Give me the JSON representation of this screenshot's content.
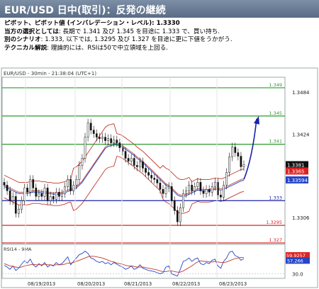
{
  "header": {
    "title": "EUR/USD 日中(取引)：反発の継続",
    "pivot_label": "ピボット、ピボット値 (インバレデーション・レベル): 1.3330",
    "preferred_label": "当方の選択としては",
    "preferred_text": ": 長期で 1.341 及び 1.345 を目途に 1.333 で、買い持ち.",
    "alternative_label": "別のシナリオ",
    "alternative_text": ": 1.333, 以下では, 1.3295 及び 1.327 を目途に更に下値をうかがう.",
    "technical_label": "テクニカル解説",
    "technical_text": ": 理論的には、RSIは50で中立領域を上回る."
  },
  "chart_data": {
    "type": "line",
    "title": "EUR/USD - 30min - 21:38:04 (UTC+1)",
    "price_panel": {
      "ylim": [
        1.3268,
        1.3505
      ],
      "y_ticks": [
        "1.3484",
        "1.3424",
        "1.3366",
        "1.3306"
      ],
      "current_price": "1.3381",
      "ma_value": "1.33594",
      "ma_red_value": "1.3365",
      "levels": [
        {
          "label": "1.349",
          "value": 1.349,
          "color": "#2e9a2e"
        },
        {
          "label": "1.345",
          "value": 1.345,
          "color": "#2e9a2e"
        },
        {
          "label": "1.341",
          "value": 1.341,
          "color": "#2e9a2e"
        },
        {
          "label": "1.333",
          "value": 1.333,
          "color": "#1a23a8"
        },
        {
          "label": "1.3295",
          "value": 1.3295,
          "color": "#d22"
        },
        {
          "label": "1.327",
          "value": 1.327,
          "color": "#d22"
        }
      ],
      "close": [
        1.3352,
        1.3344,
        1.333,
        1.3336,
        1.3312,
        1.3318,
        1.333,
        1.3348,
        1.3342,
        1.336,
        1.3348,
        1.3336,
        1.334,
        1.3336,
        1.3348,
        1.333,
        1.3336,
        1.3332,
        1.3342,
        1.3336,
        1.334,
        1.335,
        1.336,
        1.3344,
        1.3352,
        1.336,
        1.338,
        1.339,
        1.342,
        1.344,
        1.343,
        1.3425,
        1.342,
        1.3418,
        1.342,
        1.3415,
        1.3418,
        1.3412,
        1.3416,
        1.3412,
        1.3405,
        1.34,
        1.339,
        1.3386,
        1.339,
        1.338,
        1.3378,
        1.3385,
        1.3376,
        1.337,
        1.3366,
        1.3362,
        1.336,
        1.3355,
        1.3346,
        1.334,
        1.3348,
        1.335,
        1.333,
        1.3316,
        1.33,
        1.332,
        1.334,
        1.3344,
        1.3352,
        1.3344,
        1.335,
        1.3356,
        1.3344,
        1.334,
        1.3346,
        1.3342,
        1.335,
        1.3356,
        1.3338,
        1.3335,
        1.3352,
        1.337,
        1.3392,
        1.3406,
        1.3398,
        1.3393,
        1.3378,
        1.3381
      ],
      "ma": [
        1.335,
        1.3348,
        1.3346,
        1.3344,
        1.3342,
        1.334,
        1.334,
        1.334,
        1.334,
        1.3341,
        1.3342,
        1.3342,
        1.3342,
        1.3341,
        1.3341,
        1.334,
        1.334,
        1.3339,
        1.3339,
        1.3339,
        1.334,
        1.3341,
        1.3343,
        1.3344,
        1.3346,
        1.3348,
        1.3352,
        1.3356,
        1.3362,
        1.3368,
        1.3374,
        1.338,
        1.3386,
        1.3392,
        1.3398,
        1.3404,
        1.3407,
        1.3408,
        1.3409,
        1.3409,
        1.3408,
        1.3406,
        1.3403,
        1.34,
        1.3397,
        1.3394,
        1.339,
        1.3387,
        1.3384,
        1.338,
        1.3376,
        1.3372,
        1.3368,
        1.3364,
        1.336,
        1.3356,
        1.3352,
        1.335,
        1.3346,
        1.3342,
        1.3338,
        1.3336,
        1.3336,
        1.3337,
        1.3339,
        1.3341,
        1.3343,
        1.3345,
        1.3344,
        1.3344,
        1.3344,
        1.3344,
        1.3345,
        1.3346,
        1.3346,
        1.3345,
        1.3346,
        1.3348,
        1.335,
        1.3352,
        1.3354,
        1.3356,
        1.3358,
        1.3359
      ],
      "projection": [
        1.336,
        1.3446
      ]
    },
    "rsi_panel": {
      "title": "RSI14 - 9MA",
      "ylim": [
        22,
        82
      ],
      "y_ticks": [
        "30.0"
      ],
      "value_red": "59.9257",
      "value_blue": "57.266",
      "rsi": [
        45,
        42,
        38,
        44,
        36,
        40,
        47,
        53,
        49,
        56,
        46,
        42,
        48,
        44,
        50,
        42,
        46,
        44,
        50,
        46,
        48,
        54,
        60,
        46,
        52,
        58,
        64,
        66,
        70,
        66,
        58,
        56,
        52,
        50,
        52,
        48,
        50,
        46,
        50,
        47,
        44,
        42,
        38,
        40,
        44,
        38,
        40,
        46,
        40,
        38,
        36,
        35,
        34,
        32,
        30,
        32,
        42,
        44,
        30,
        28,
        26,
        38,
        52,
        54,
        58,
        52,
        56,
        58,
        48,
        46,
        50,
        48,
        54,
        56,
        44,
        40,
        52,
        58,
        68,
        70,
        62,
        60,
        54,
        57
      ],
      "ma": [
        48,
        46,
        44,
        43,
        42,
        41,
        42,
        44,
        45,
        46,
        47,
        46,
        46,
        46,
        47,
        46,
        46,
        45,
        46,
        46,
        46,
        47,
        49,
        49,
        50,
        52,
        54,
        56,
        58,
        60,
        61,
        61,
        60,
        59,
        58,
        56,
        54,
        52,
        51,
        49,
        48,
        47,
        45,
        44,
        44,
        43,
        42,
        42,
        42,
        41,
        40,
        39,
        38,
        37,
        35,
        34,
        34,
        35,
        35,
        34,
        33,
        33,
        35,
        38,
        41,
        44,
        48,
        51,
        53,
        52,
        52,
        51,
        51,
        52,
        51,
        50,
        50,
        51,
        53,
        55,
        57,
        58,
        59,
        59
      ]
    },
    "x_tick_labels": [
      "08/19/2013",
      "08/20/2013",
      "08/21/2013",
      "08/22/2013",
      "08/23/2013"
    ]
  }
}
